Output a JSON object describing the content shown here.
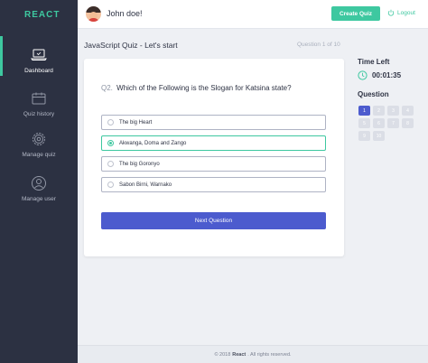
{
  "sidebar": {
    "brand": "REACT",
    "items": [
      {
        "label": "Dashboard",
        "icon": "laptop-icon",
        "active": true
      },
      {
        "label": "Quiz history",
        "icon": "calendar-icon",
        "active": false
      },
      {
        "label": "Manage quiz",
        "icon": "gear-icon",
        "active": false
      },
      {
        "label": "Manage user",
        "icon": "user-icon",
        "active": false
      }
    ]
  },
  "header": {
    "username": "John doe!",
    "create_quiz_label": "Create Quiz",
    "logout_label": "Logout"
  },
  "quiz": {
    "title": "JavaScript Quiz - Let's start",
    "counter": "Question 1 of 10",
    "question_number": "Q2.",
    "question_text": "Which of the Following is the Slogan for Katsina state?",
    "options": [
      {
        "label": "The big Heart",
        "selected": false
      },
      {
        "label": "Akwanga, Doma and Zango",
        "selected": true
      },
      {
        "label": "The big Goronyo",
        "selected": false
      },
      {
        "label": "Sabon Birni, Warnako",
        "selected": false
      }
    ],
    "next_label": "Next Question"
  },
  "panel": {
    "time_left_label": "Time Left",
    "time_value": "00:01:35",
    "question_label": "Question",
    "questions": [
      {
        "n": "1",
        "current": true
      },
      {
        "n": "2",
        "current": false
      },
      {
        "n": "3",
        "current": false
      },
      {
        "n": "4",
        "current": false
      },
      {
        "n": "5",
        "current": false
      },
      {
        "n": "6",
        "current": false
      },
      {
        "n": "7",
        "current": false
      },
      {
        "n": "8",
        "current": false
      },
      {
        "n": "9",
        "current": false
      },
      {
        "n": "10",
        "current": false
      }
    ]
  },
  "footer": {
    "prefix": "© 2018",
    "brand": "React",
    "suffix": ". All rights reserved."
  },
  "colors": {
    "sidebar_bg": "#2c3142",
    "accent_green": "#3ec8a0",
    "primary_blue": "#4c5bce"
  }
}
